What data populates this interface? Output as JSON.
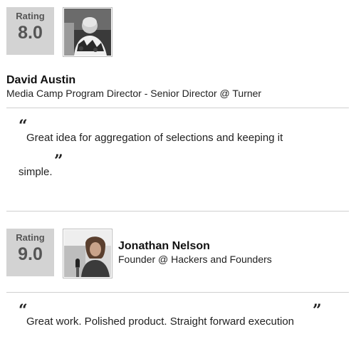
{
  "reviews": [
    {
      "rating_label": "Rating",
      "rating_value": "8.0",
      "name": "David Austin",
      "title": "Media Camp Program Director - Senior Director @ Turner",
      "quote_open": "“",
      "quote_close": "”",
      "quote_line1": "Great idea for aggregation of selections and keeping it",
      "quote_line2": "simple."
    },
    {
      "rating_label": "Rating",
      "rating_value": "9.0",
      "name": "Jonathan Nelson",
      "title": "Founder @ Hackers and Founders",
      "quote_open": "“",
      "quote_close": "”",
      "quote_line1": "Great work. Polished product. Straight forward execution"
    }
  ],
  "colors": {
    "rating_box": "#d3d3d3",
    "divider": "#cfcfcf"
  },
  "icons": {
    "avatar1": "person-photo",
    "avatar2": "person-photo-with-microphone"
  }
}
